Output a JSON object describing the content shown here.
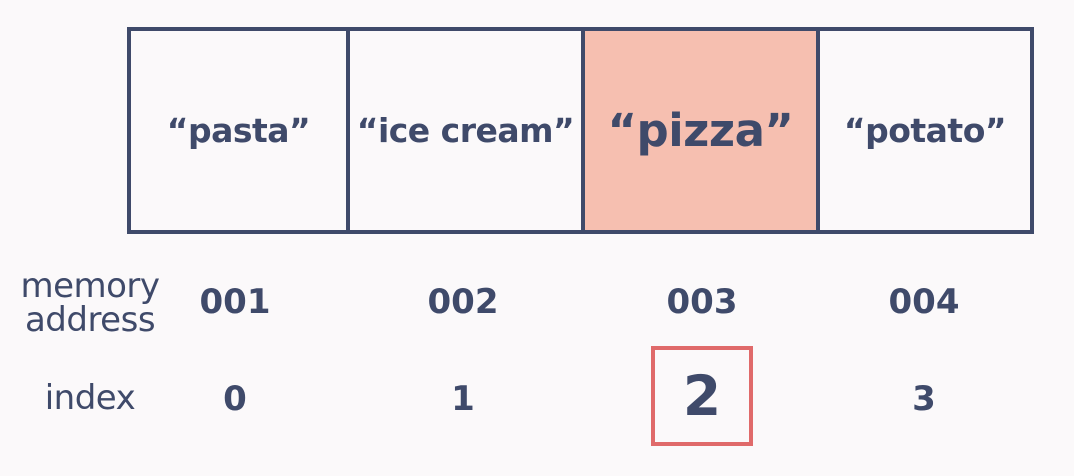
{
  "array": {
    "cells": [
      {
        "value": "“pasta”"
      },
      {
        "value": "“ice cream”"
      },
      {
        "value": "“pizza”"
      },
      {
        "value": "“potato”"
      }
    ],
    "highlight_index": 2,
    "highlight_color": "#f6bfb0"
  },
  "labels": {
    "memory_address": "memory address",
    "index": "index"
  },
  "addresses": [
    "001",
    "002",
    "003",
    "004"
  ],
  "indices": [
    "0",
    "1",
    "2",
    "3"
  ],
  "colors": {
    "text": "#3f4a6a",
    "border": "#3f4a6a",
    "index_box": "#e06a6a",
    "background": "#fbf9fa"
  }
}
